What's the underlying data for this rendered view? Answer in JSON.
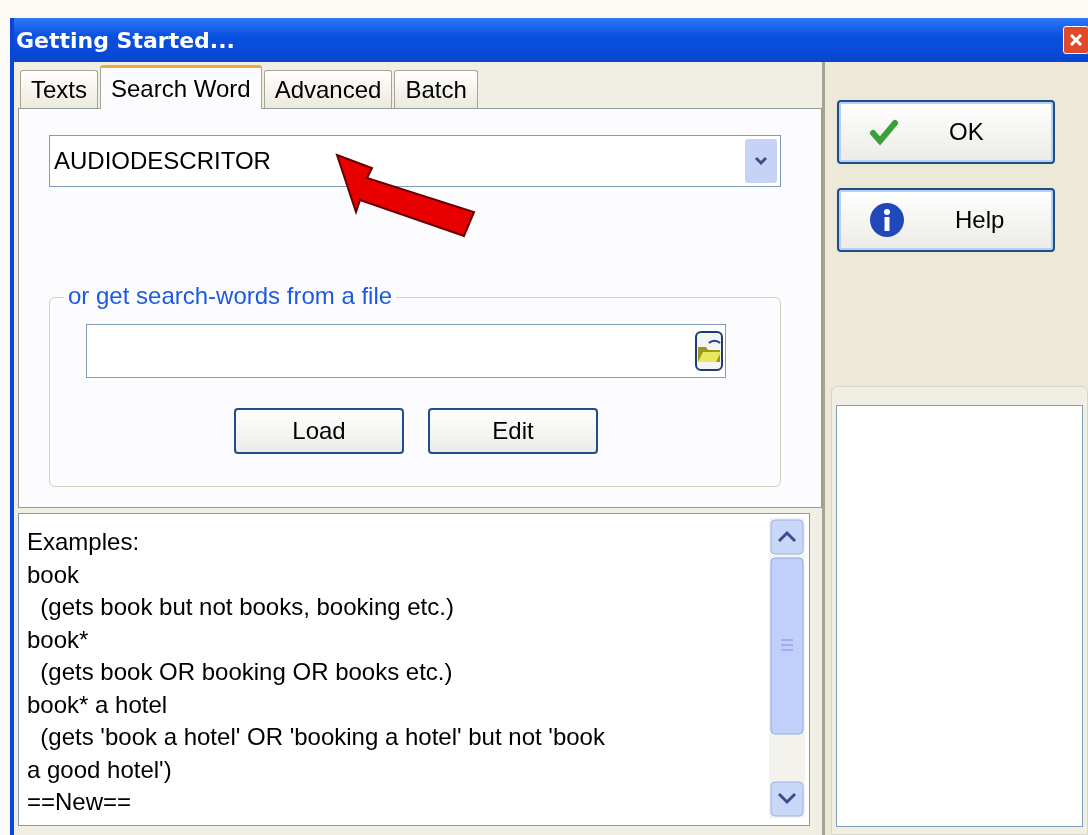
{
  "window": {
    "title": "Getting Started..."
  },
  "tabs": [
    {
      "label": "Texts",
      "selected": false
    },
    {
      "label": "Search Word",
      "selected": true
    },
    {
      "label": "Advanced",
      "selected": false
    },
    {
      "label": "Batch",
      "selected": false
    }
  ],
  "search_combo": {
    "value": "AUDIODESCRITOR"
  },
  "file_group": {
    "legend": "or get search-words from a file",
    "buttons": [
      "Load",
      "Edit"
    ]
  },
  "examples": [
    "Examples:",
    "book",
    "  (gets book but not books, booking etc.)",
    "book*",
    "  (gets book OR booking OR books etc.)",
    "book* a hotel",
    "  (gets 'book a hotel' OR 'booking a hotel' but not 'book",
    "a good hotel')",
    "==New=="
  ],
  "side_buttons": [
    {
      "label": "OK",
      "kind": "ok"
    },
    {
      "label": "Help",
      "kind": "help"
    }
  ]
}
